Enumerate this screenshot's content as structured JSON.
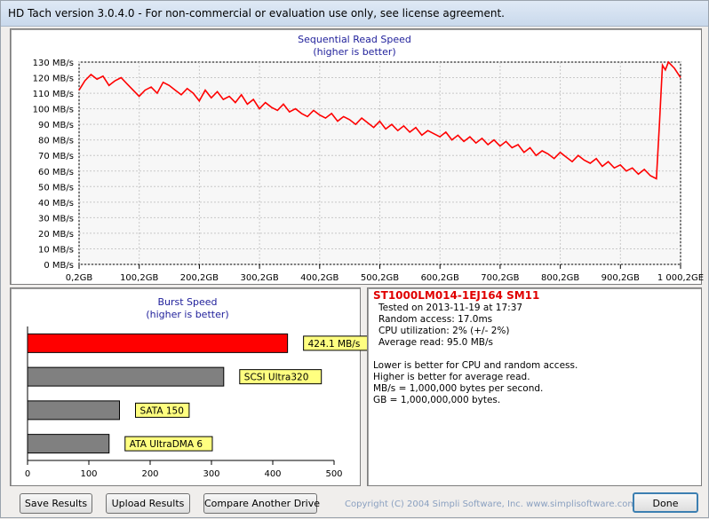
{
  "window": {
    "title": "HD Tach version 3.0.4.0  - For non-commercial or evaluation use only, see license agreement."
  },
  "seq_chart": {
    "title": "Sequential Read Speed",
    "subtitle": "(higher is better)",
    "y_ticks": [
      "0 MB/s",
      "10 MB/s",
      "20 MB/s",
      "30 MB/s",
      "40 MB/s",
      "50 MB/s",
      "60 MB/s",
      "70 MB/s",
      "80 MB/s",
      "90 MB/s",
      "100 MB/s",
      "110 MB/s",
      "120 MB/s",
      "130 MB/s"
    ],
    "x_ticks": [
      "0,2GB",
      "100,2GB",
      "200,2GB",
      "300,2GB",
      "400,2GB",
      "500,2GB",
      "600,2GB",
      "700,2GB",
      "800,2GB",
      "900,2GB",
      "1 000,2GE"
    ],
    "line_color": "#ff0000",
    "grid_color": "#c8c8c8"
  },
  "burst_chart": {
    "title": "Burst Speed",
    "subtitle": "(higher is better)",
    "x_ticks": [
      "0",
      "100",
      "200",
      "300",
      "400",
      "500"
    ],
    "label_bg": "#ffff80"
  },
  "drive": {
    "name": "ST1000LM014-1EJ164 SM11",
    "tested": "Tested on 2013-11-19 at 17:37",
    "random_access": "Random access: 17.0ms",
    "cpu": "CPU utilization: 2% (+/- 2%)",
    "avg_read": "Average read: 95.0 MB/s"
  },
  "notes": [
    "Lower is better for CPU and random access.",
    "Higher is better for average read.",
    "MB/s = 1,000,000 bytes per second.",
    "GB = 1,000,000,000 bytes."
  ],
  "buttons": {
    "save": "Save Results",
    "upload": "Upload Results",
    "compare": "Compare Another Drive",
    "done": "Done"
  },
  "copyright": "Copyright (C) 2004 Simpli Software, Inc. www.simplisoftware.com",
  "chart_data": [
    {
      "type": "line",
      "title": "Sequential Read Speed",
      "subtitle": "(higher is better)",
      "xlabel": "",
      "ylabel": "",
      "xlim": [
        0.2,
        1000.2
      ],
      "ylim": [
        0,
        130
      ],
      "x": [
        0.2,
        10,
        20,
        30,
        40,
        50,
        60,
        70,
        80,
        90,
        100,
        110,
        120,
        130,
        140,
        150,
        160,
        170,
        180,
        190,
        200,
        210,
        220,
        230,
        240,
        250,
        260,
        270,
        280,
        290,
        300,
        310,
        320,
        330,
        340,
        350,
        360,
        370,
        380,
        390,
        400,
        410,
        420,
        430,
        440,
        450,
        460,
        470,
        480,
        490,
        500,
        510,
        520,
        530,
        540,
        550,
        560,
        570,
        580,
        590,
        600,
        610,
        620,
        630,
        640,
        650,
        660,
        670,
        680,
        690,
        700,
        710,
        720,
        730,
        740,
        750,
        760,
        770,
        780,
        790,
        800,
        810,
        820,
        830,
        840,
        850,
        860,
        870,
        880,
        890,
        900,
        910,
        920,
        930,
        940,
        950,
        960,
        965,
        970,
        975,
        980,
        990,
        1000.2
      ],
      "series": [
        {
          "values": [
            112,
            118,
            122,
            119,
            121,
            115,
            118,
            120,
            116,
            112,
            108,
            112,
            114,
            110,
            117,
            115,
            112,
            109,
            113,
            110,
            105,
            112,
            107,
            111,
            106,
            108,
            104,
            109,
            103,
            106,
            100,
            104,
            101,
            99,
            103,
            98,
            100,
            97,
            95,
            99,
            96,
            94,
            97,
            92,
            95,
            93,
            90,
            94,
            91,
            88,
            92,
            87,
            90,
            86,
            89,
            85,
            88,
            83,
            86,
            84,
            82,
            85,
            80,
            83,
            79,
            82,
            78,
            81,
            77,
            80,
            76,
            79,
            75,
            77,
            72,
            75,
            70,
            73,
            71,
            68,
            72,
            69,
            66,
            70,
            67,
            65,
            68,
            63,
            66,
            62,
            64,
            60,
            62,
            58,
            61,
            57,
            55,
            90,
            128,
            125,
            130,
            126,
            120
          ]
        }
      ]
    },
    {
      "type": "bar",
      "title": "Burst Speed",
      "subtitle": "(higher is better)",
      "categories": [
        "424.1 MB/s",
        "SCSI Ultra320",
        "SATA 150",
        "ATA UltraDMA 6"
      ],
      "values": [
        424.1,
        320,
        150,
        133
      ],
      "colors": [
        "#ff0000",
        "#808080",
        "#808080",
        "#808080"
      ],
      "xlim": [
        0,
        500
      ]
    }
  ]
}
